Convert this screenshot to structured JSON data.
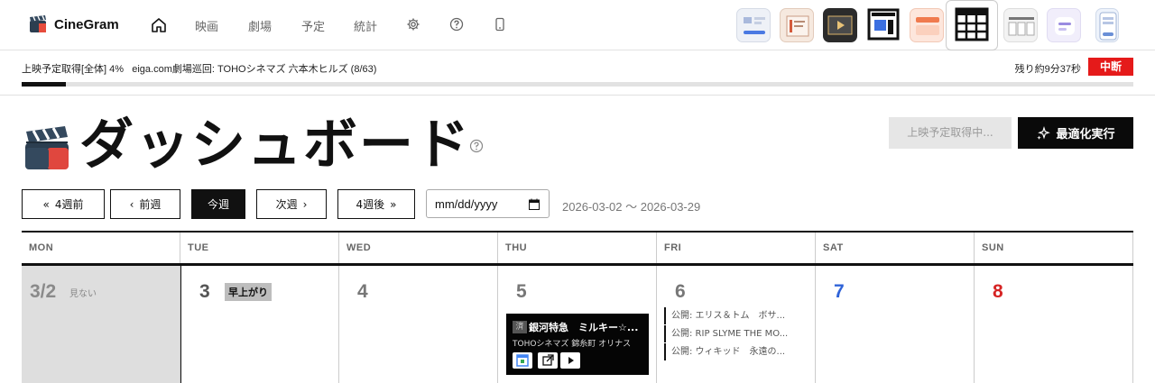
{
  "brand": {
    "name": "CineGram"
  },
  "nav": {
    "links": [
      "映画",
      "劇場",
      "予定",
      "統計"
    ]
  },
  "progress": {
    "label": "上映予定取得[全体] 4%",
    "detail": "eiga.com劇場巡回: TOHOシネマズ 六本木ヒルズ (8/63)",
    "remaining": "残り約9分37秒",
    "stop_label": "中断",
    "percent": 4
  },
  "page": {
    "title": "ダッシュボード",
    "loading_button": "上映予定取得中...",
    "optimize_button": "最適化実行"
  },
  "week_nav": {
    "back4": "4週前",
    "prev": "前週",
    "this_week": "今週",
    "next": "次週",
    "fwd4": "4週後",
    "date_placeholder": "mm/dd/yyyy",
    "range": "2026-03-02 〜 2026-03-29"
  },
  "calendar": {
    "days": [
      {
        "dow": "MON",
        "date": "3/2",
        "tag": "見ない"
      },
      {
        "dow": "TUE",
        "date": "3",
        "tag": "早上がり"
      },
      {
        "dow": "WED",
        "date": "4"
      },
      {
        "dow": "THU",
        "date": "5"
      },
      {
        "dow": "FRI",
        "date": "6"
      },
      {
        "dow": "SAT",
        "date": "7"
      },
      {
        "dow": "SUN",
        "date": "8"
      }
    ],
    "showing": {
      "badge": "済",
      "title": "銀河特急　ミルキー☆...",
      "theater": "TOHOシネマズ 錦糸町 オリナス"
    },
    "releases": [
      "公開: エリス＆トム　ボサ...",
      "公開: RIP SLYME THE MO...",
      "公開: ウィキッド　永遠の..."
    ]
  },
  "colors": {
    "accent": "#111111",
    "stop": "#e51a1a",
    "saturday": "#2f63d8",
    "sunday": "#d62424"
  }
}
